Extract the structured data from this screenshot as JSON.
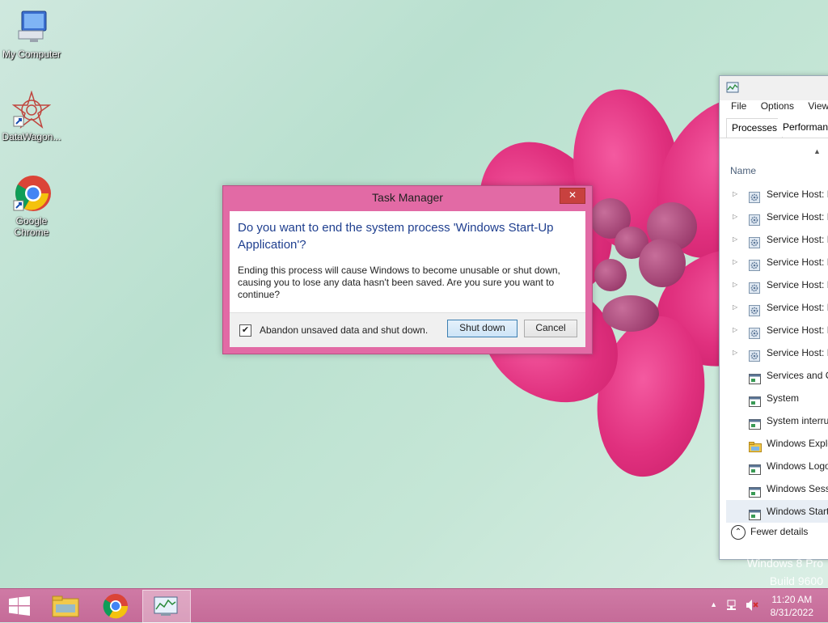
{
  "desktop": {
    "icons": [
      {
        "label": "My Computer",
        "icon": "computer-icon"
      },
      {
        "label": "DataWagon...",
        "icon": "datawagon-icon"
      },
      {
        "label": "Google Chrome",
        "icon": "chrome-icon"
      }
    ],
    "watermark": {
      "line1": "Windows 8 Pro",
      "line2": "Build 9600"
    }
  },
  "task_manager_window": {
    "menu": [
      "File",
      "Options",
      "View"
    ],
    "tabs": [
      "Processes",
      "Performance"
    ],
    "column_header": "Name",
    "processes": [
      {
        "name": "Service Host: L",
        "expandable": true,
        "icon": "gear-icon"
      },
      {
        "name": "Service Host: L",
        "expandable": true,
        "icon": "gear-icon"
      },
      {
        "name": "Service Host: L",
        "expandable": true,
        "icon": "gear-icon"
      },
      {
        "name": "Service Host: L",
        "expandable": true,
        "icon": "gear-icon"
      },
      {
        "name": "Service Host: L",
        "expandable": true,
        "icon": "gear-icon"
      },
      {
        "name": "Service Host: N",
        "expandable": true,
        "icon": "gear-icon"
      },
      {
        "name": "Service Host: N",
        "expandable": true,
        "icon": "gear-icon"
      },
      {
        "name": "Service Host: R",
        "expandable": true,
        "icon": "gear-icon"
      },
      {
        "name": "Services and C",
        "expandable": false,
        "icon": "app-window-icon"
      },
      {
        "name": "System",
        "expandable": false,
        "icon": "app-window-icon"
      },
      {
        "name": "System interru",
        "expandable": false,
        "icon": "app-window-icon"
      },
      {
        "name": "Windows Explo",
        "expandable": false,
        "icon": "folder-icon"
      },
      {
        "name": "Windows Logo",
        "expandable": false,
        "icon": "app-window-icon"
      },
      {
        "name": "Windows Sessi",
        "expandable": false,
        "icon": "app-window-icon"
      },
      {
        "name": "Windows Start",
        "expandable": false,
        "icon": "app-window-icon",
        "selected": true
      }
    ],
    "fewer_details": "Fewer details"
  },
  "dialog": {
    "title": "Task Manager",
    "close_glyph": "✕",
    "question": "Do you want to end the system process 'Windows Start-Up Application'?",
    "detail": "Ending this process will cause Windows to become unusable or shut down, causing you to lose any data hasn't been saved. Are you sure you want to continue?",
    "checkbox_label": "Abandon unsaved data and shut down.",
    "checkbox_checked": true,
    "primary_button": "Shut down",
    "cancel_button": "Cancel"
  },
  "taskbar": {
    "buttons": [
      "start-icon",
      "file-explorer-icon",
      "chrome-icon",
      "task-manager-icon"
    ],
    "time": "11:20 AM",
    "date": "8/31/2022"
  },
  "colors": {
    "accent": "#e26aa5",
    "taskbar": "#c96f9d",
    "question_text": "#1f3f8f",
    "close_button": "#c8413f"
  }
}
